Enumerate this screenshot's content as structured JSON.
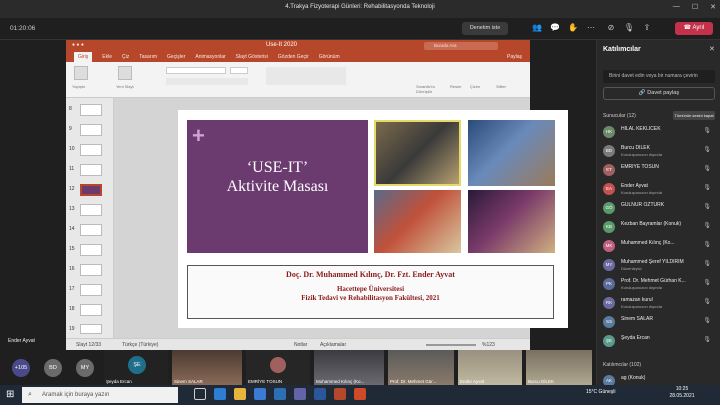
{
  "app": {
    "title": "4.Trakya Fizyoterapi Günleri: Rehabilitasyonda Teknoloji",
    "timer": "01:20:06",
    "end_button": "Ayrıl",
    "audit_button": "Denetim iste"
  },
  "powerpoint": {
    "title": "Use-It 2020",
    "search_placeholder": "Burada Ara",
    "tabs": [
      "Giriş",
      "Ekle",
      "Çiz",
      "Tasarım",
      "Geçişler",
      "Animasyonlar",
      "Slayt Gösterisi",
      "Gözden Geçir",
      "Görünüm"
    ],
    "share_label": "Paylaş",
    "ribbon_labels": [
      "Yapıştır",
      "Yeni Slayt",
      "SmartArt'a Dönüştür",
      "Resim",
      "Çizim",
      "Stiller"
    ],
    "slide_numbers": [
      "8",
      "9",
      "10",
      "11",
      "12",
      "13",
      "14",
      "15",
      "16",
      "17",
      "18",
      "19"
    ],
    "status_slide": "Slayt 12/33",
    "status_language": "Türkçe (Türkiye)",
    "status_notes": "Notlar",
    "status_comments": "Açıklamalar",
    "zoom": "%123"
  },
  "slide": {
    "plus": "+",
    "title_line1": "‘USE-IT’",
    "title_line2": "Aktivite Masası",
    "authors": "Doç. Dr. Muhammed Kılınç, Dr. Fzt. Ender Ayvat",
    "university": "Hacettepe Üniversitesi",
    "faculty": "Fizik Tedavi ve Rehabilitasyon Fakültesi, 2021"
  },
  "panel": {
    "title": "Katılımcılar",
    "search_placeholder": "Birini davet edin veya bir numara çevirin",
    "share_invite": "Davet paylaş",
    "presenters_header": "Sunucular (12)",
    "mute_all": "Tümünün sesini kapat",
    "attendees_header": "Katılımcılar (102)",
    "participants": [
      {
        "initials": "HK",
        "name": "HİLAL KEKLİCEK",
        "sub": "",
        "color": "#6a8a6a"
      },
      {
        "initials": "BD",
        "name": "Burcu DİLEK",
        "sub": "Kuruluşunuzun dışında",
        "color": "#7a7a7a"
      },
      {
        "initials": "ET",
        "name": "EMRİYE TOSUN",
        "sub": "",
        "color": "#a06060"
      },
      {
        "initials": "EA",
        "name": "Ender Ayvat",
        "sub": "Kuruluşunuzun dışında",
        "color": "#c75050"
      },
      {
        "initials": "GÖ",
        "name": "GÜLNUR ÖZTÜRK",
        "sub": "",
        "color": "#5a9a6a"
      },
      {
        "initials": "KB",
        "name": "Kezban Bayramlar (Konuk)",
        "sub": "",
        "color": "#5a9a6a"
      },
      {
        "initials": "MK",
        "name": "Muhammed Kılınç (Ko...",
        "sub": "",
        "color": "#c06080"
      },
      {
        "initials": "MY",
        "name": "Muhammed Şeref YILDIRIM",
        "sub": "Düzenleyici",
        "color": "#6a6aa0"
      },
      {
        "initials": "PK",
        "name": "Prof. Dr. Mehmet Gürhan K...",
        "sub": "Kuruluşunuzun dışında",
        "color": "#5a6a9a"
      },
      {
        "initials": "RK",
        "name": "ramazan kurul",
        "sub": "Kuruluşunuzun dışında",
        "color": "#6a6aa0"
      },
      {
        "initials": "SS",
        "name": "Sinem SALAR",
        "sub": "",
        "color": "#5a7aa0"
      },
      {
        "initials": "ŞE",
        "name": "Şeyda Ercan",
        "sub": "",
        "color": "#5a9a8a"
      }
    ],
    "attendee_first": {
      "initials": "AK",
      "name": "ag (Konuk)",
      "color": "#5a7aa0"
    }
  },
  "video_strip": {
    "presenter_label": "Ender Ayvat",
    "more_count": "+105",
    "bubbles": [
      {
        "initials": "BD",
        "color": "#6b6b6b"
      },
      {
        "initials": "MY",
        "color": "#6b6b6b"
      },
      {
        "initials": "ŞE",
        "color": "#1f6f8b"
      }
    ],
    "tiles": [
      "Şeyda Ercan",
      "Sinem SALAR",
      "EMRİYE TOSUN",
      "Muhammed Kılınç (Ko...",
      "Prof. Dr. Mehmet Gür...",
      "Ender Ayvat",
      "Burcu DİLEK"
    ]
  },
  "taskbar": {
    "search_placeholder": "Aramak için buraya yazın",
    "tray": "15°C Güneşli",
    "time": "10:25",
    "date": "28.05.2021"
  }
}
